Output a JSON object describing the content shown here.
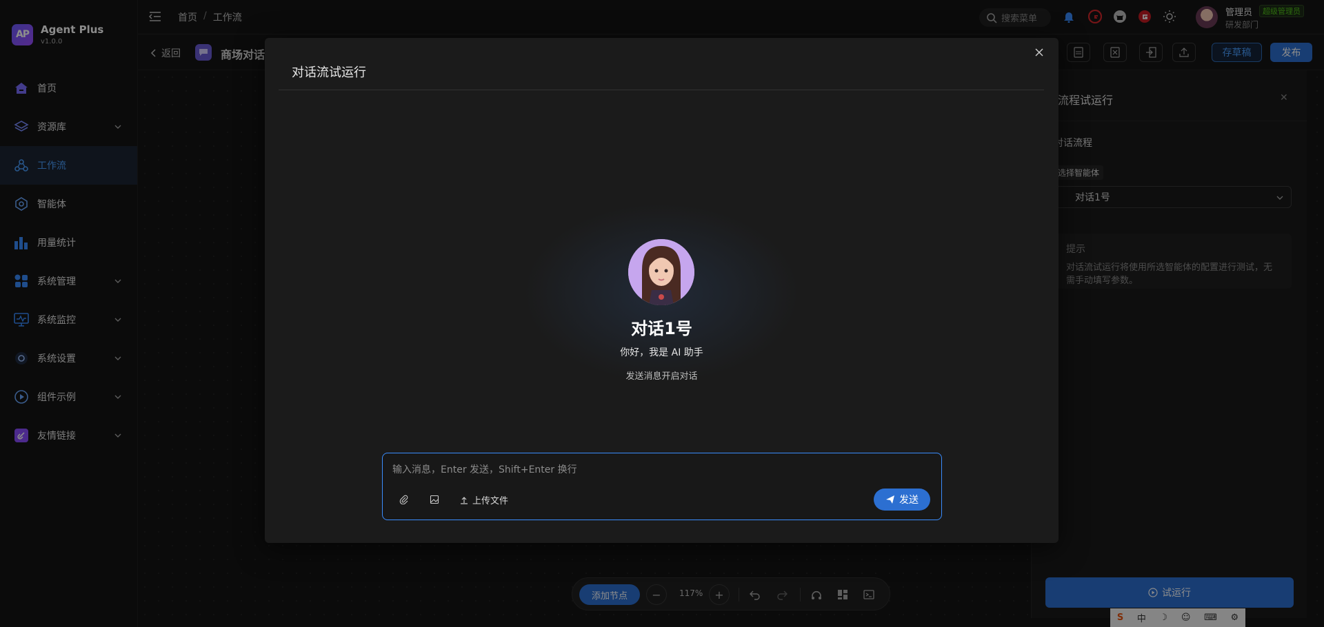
{
  "brand": {
    "logo": "AP",
    "name": "Agent Plus",
    "version": "v1.0.0"
  },
  "sidebar": {
    "items": [
      {
        "label": "首页",
        "icon": "home-icon"
      },
      {
        "label": "资源库",
        "icon": "layers-icon"
      },
      {
        "label": "工作流",
        "icon": "workflow-icon"
      },
      {
        "label": "智能体",
        "icon": "agent-icon"
      },
      {
        "label": "用量统计",
        "icon": "bar-chart-icon"
      },
      {
        "label": "系统管理",
        "icon": "grid-icon"
      },
      {
        "label": "系统监控",
        "icon": "monitor-icon"
      },
      {
        "label": "系统设置",
        "icon": "settings-icon"
      },
      {
        "label": "组件示例",
        "icon": "play-icon"
      },
      {
        "label": "友情链接",
        "icon": "link-icon"
      }
    ]
  },
  "header": {
    "breadcrumb": [
      "首页",
      "工作流"
    ],
    "search_placeholder": "搜索菜单",
    "user": {
      "name": "管理员",
      "role": "超级管理员",
      "dept": "研发部门"
    }
  },
  "toolbar": {
    "back_label": "返回",
    "workflow_title": "商场对话",
    "draft_label": "存草稿",
    "publish_label": "发布"
  },
  "right_panel": {
    "title": "流程试运行",
    "section": "对话流程",
    "tag": "选择智能体",
    "selected_agent": "对话1号",
    "tip_title": "提示",
    "tip_text": "对话流试运行将使用所选智能体的配置进行测试，无需手动填写参数。",
    "run_label": "试运行"
  },
  "canvas_tools": {
    "add_node": "添加节点",
    "zoom": "117%",
    "zoom_out": "−",
    "zoom_in": "+"
  },
  "ime": [
    "S",
    "中",
    "☽",
    "☺",
    "⌨",
    "⚙"
  ],
  "modal": {
    "title": "对话流试运行",
    "bot_name": "对话1号",
    "greeting": "你好，我是 AI 助手",
    "hint": "发送消息开启对话",
    "input_placeholder": "输入消息，Enter 发送，Shift+Enter 换行",
    "upload_label": "上传文件",
    "send_label": "发送"
  },
  "colors": {
    "accent": "#2c6fd1",
    "active_bg": "#1c2633",
    "active_text": "#4a9eff",
    "role_green": "#52c41a"
  }
}
